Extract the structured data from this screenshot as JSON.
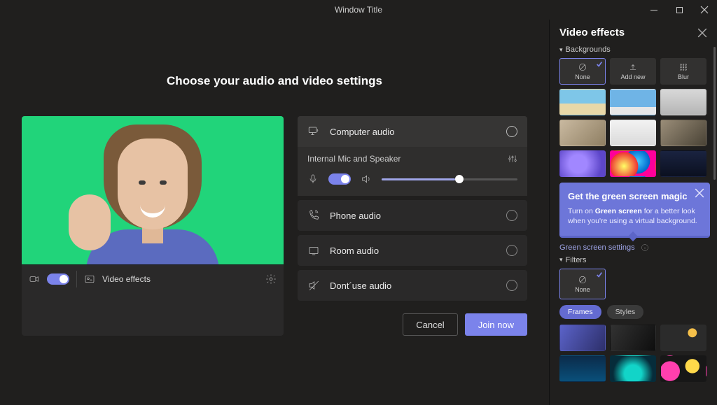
{
  "titlebar": {
    "title": "Window Title"
  },
  "main": {
    "heading": "Choose your audio and video settings",
    "video": {
      "effects_label": "Video effects",
      "camera_on": true
    },
    "audio": {
      "computer": {
        "label": "Computer audio",
        "selected": true
      },
      "device_label": "Internal Mic and Speaker",
      "mic_on": true,
      "volume_percent": 54,
      "phone": {
        "label": "Phone audio"
      },
      "room": {
        "label": "Room audio"
      },
      "none": {
        "label": "Dont´use audio"
      }
    },
    "actions": {
      "cancel": "Cancel",
      "join": "Join now"
    }
  },
  "sidepanel": {
    "title": "Video effects",
    "sections": {
      "backgrounds": "Backgrounds",
      "filters": "Filters"
    },
    "background_options": {
      "none": {
        "label": "None",
        "selected": true
      },
      "add_new": {
        "label": "Add new"
      },
      "blur": {
        "label": "Blur"
      }
    },
    "tip": {
      "title": "Get the green screen magic",
      "text_pre": "Turn on ",
      "text_bold": "Green screen",
      "text_post": " for a better look when you're using a virtual background."
    },
    "green_screen_link": "Green screen settings",
    "filter_none": {
      "label": "None",
      "selected": true
    },
    "filter_tabs": {
      "frames": "Frames",
      "styles": "Styles"
    }
  }
}
